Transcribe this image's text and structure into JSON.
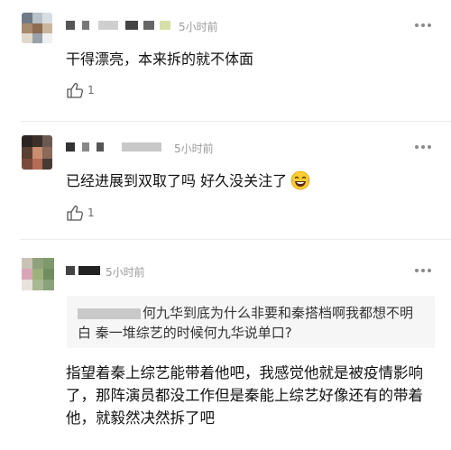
{
  "comments": [
    {
      "time": "5小时前",
      "text": "干得漂亮，本来拆的就不体面",
      "likes": "1"
    },
    {
      "time": "5小时前",
      "text": "已经进展到双取了吗 好久没关注了",
      "emoji": "laughing-tears-emoji",
      "likes": "1"
    },
    {
      "time": "5小时前",
      "quote": "何九华到底为什么非要和秦搭档啊我都想不明白 秦一堆综艺的时候何九华说单口?",
      "text": "指望着秦上综艺能带着他吧，我感觉他就是被疫情影响了，那阵演员都没工作但是秦能上综艺好像还有的带着他，就毅然决然拆了吧"
    }
  ],
  "colors": {
    "text": "#111111",
    "meta": "#9a9a9a",
    "quote_bg": "#f6f6f6",
    "divider": "#ececec"
  }
}
